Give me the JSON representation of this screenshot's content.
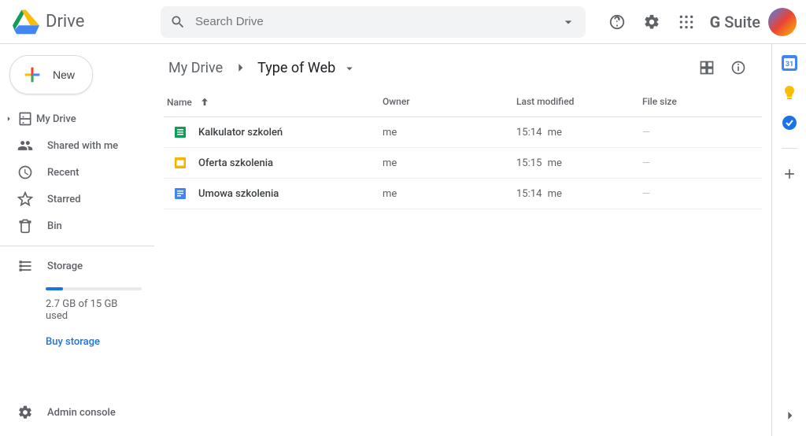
{
  "header": {
    "app_name": "Drive",
    "search_placeholder": "Search Drive",
    "gsuite_label": "G Suite"
  },
  "sidebar": {
    "new_label": "New",
    "items": [
      {
        "label": "My Drive"
      },
      {
        "label": "Shared with me"
      },
      {
        "label": "Recent"
      },
      {
        "label": "Starred"
      },
      {
        "label": "Bin"
      }
    ],
    "storage_label": "Storage",
    "storage_used_text": "2.7 GB of 15 GB used",
    "buy_storage_label": "Buy storage",
    "admin_label": "Admin console"
  },
  "breadcrumb": {
    "root": "My Drive",
    "current": "Type of Web"
  },
  "table": {
    "columns": {
      "name": "Name",
      "owner": "Owner",
      "modified": "Last modified",
      "size": "File size"
    },
    "rows": [
      {
        "name": "Kalkulator szkoleń",
        "icon_type": "sheets",
        "icon_color": "#0f9d58",
        "owner": "me",
        "modified_time": "15:14",
        "modified_by": "me",
        "size": "—"
      },
      {
        "name": "Oferta szkolenia",
        "icon_type": "slides",
        "icon_color": "#f4b400",
        "owner": "me",
        "modified_time": "15:15",
        "modified_by": "me",
        "size": "—"
      },
      {
        "name": "Umowa szkolenia",
        "icon_type": "docs",
        "icon_color": "#4285f4",
        "owner": "me",
        "modified_time": "15:14",
        "modified_by": "me",
        "size": "—"
      }
    ]
  }
}
